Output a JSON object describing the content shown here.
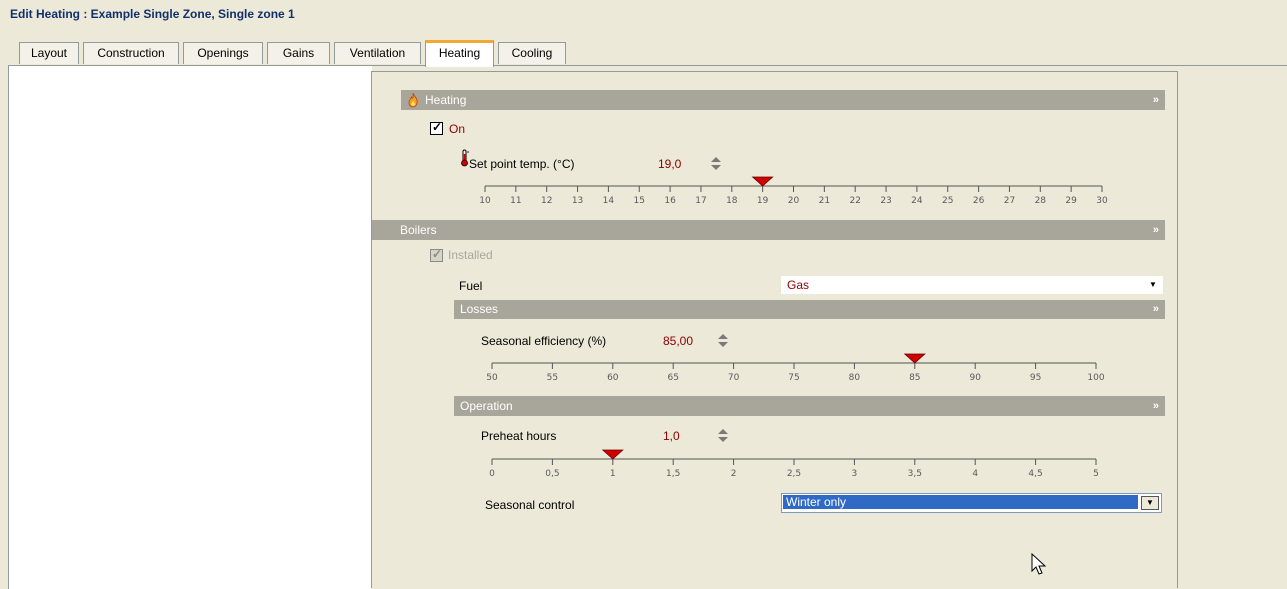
{
  "window": {
    "title": "Edit Heating : Example Single Zone, Single zone 1"
  },
  "tabs": [
    {
      "label": "Layout"
    },
    {
      "label": "Construction"
    },
    {
      "label": "Openings"
    },
    {
      "label": "Gains"
    },
    {
      "label": "Ventilation"
    },
    {
      "label": "Heating",
      "active": true
    },
    {
      "label": "Cooling"
    }
  ],
  "heating": {
    "header": "Heating",
    "on_label": "On",
    "on_checked": true,
    "setpoint_label": "Set point temp. (°C)",
    "setpoint_value": "19,0",
    "setpoint_ticks": [
      "10",
      "11",
      "12",
      "13",
      "14",
      "15",
      "16",
      "17",
      "18",
      "19",
      "20",
      "21",
      "22",
      "23",
      "24",
      "25",
      "26",
      "27",
      "28",
      "29",
      "30"
    ],
    "setpoint_level": 19
  },
  "boilers": {
    "header": "Boilers",
    "installed_label": "Installed",
    "installed_checked": true,
    "fuel_label": "Fuel",
    "fuel_value": "Gas",
    "losses": {
      "header": "Losses",
      "efficiency_label": "Seasonal efficiency (%)",
      "efficiency_value": "85,00",
      "efficiency_ticks": [
        "50",
        "55",
        "60",
        "65",
        "70",
        "75",
        "80",
        "85",
        "90",
        "95",
        "100"
      ],
      "efficiency_level": 85
    },
    "operation": {
      "header": "Operation",
      "preheat_label": "Preheat hours",
      "preheat_value": "1,0",
      "preheat_ticks": [
        "0",
        "0,5",
        "1",
        "1,5",
        "2",
        "2,5",
        "3",
        "3,5",
        "4",
        "4,5",
        "5"
      ],
      "preheat_level": 1,
      "control_label": "Seasonal control",
      "control_value": "Winter only"
    }
  },
  "colors": {
    "bar": "#A8A69A",
    "value": "#8B0000",
    "active_tab": "#F0A830",
    "selection": "#316AC5"
  },
  "icons": {
    "heating": "flame-icon",
    "thermometer": "thermometer-icon",
    "chevron": "double-chevron-down-icon",
    "cursor": "mouse-pointer-icon"
  }
}
